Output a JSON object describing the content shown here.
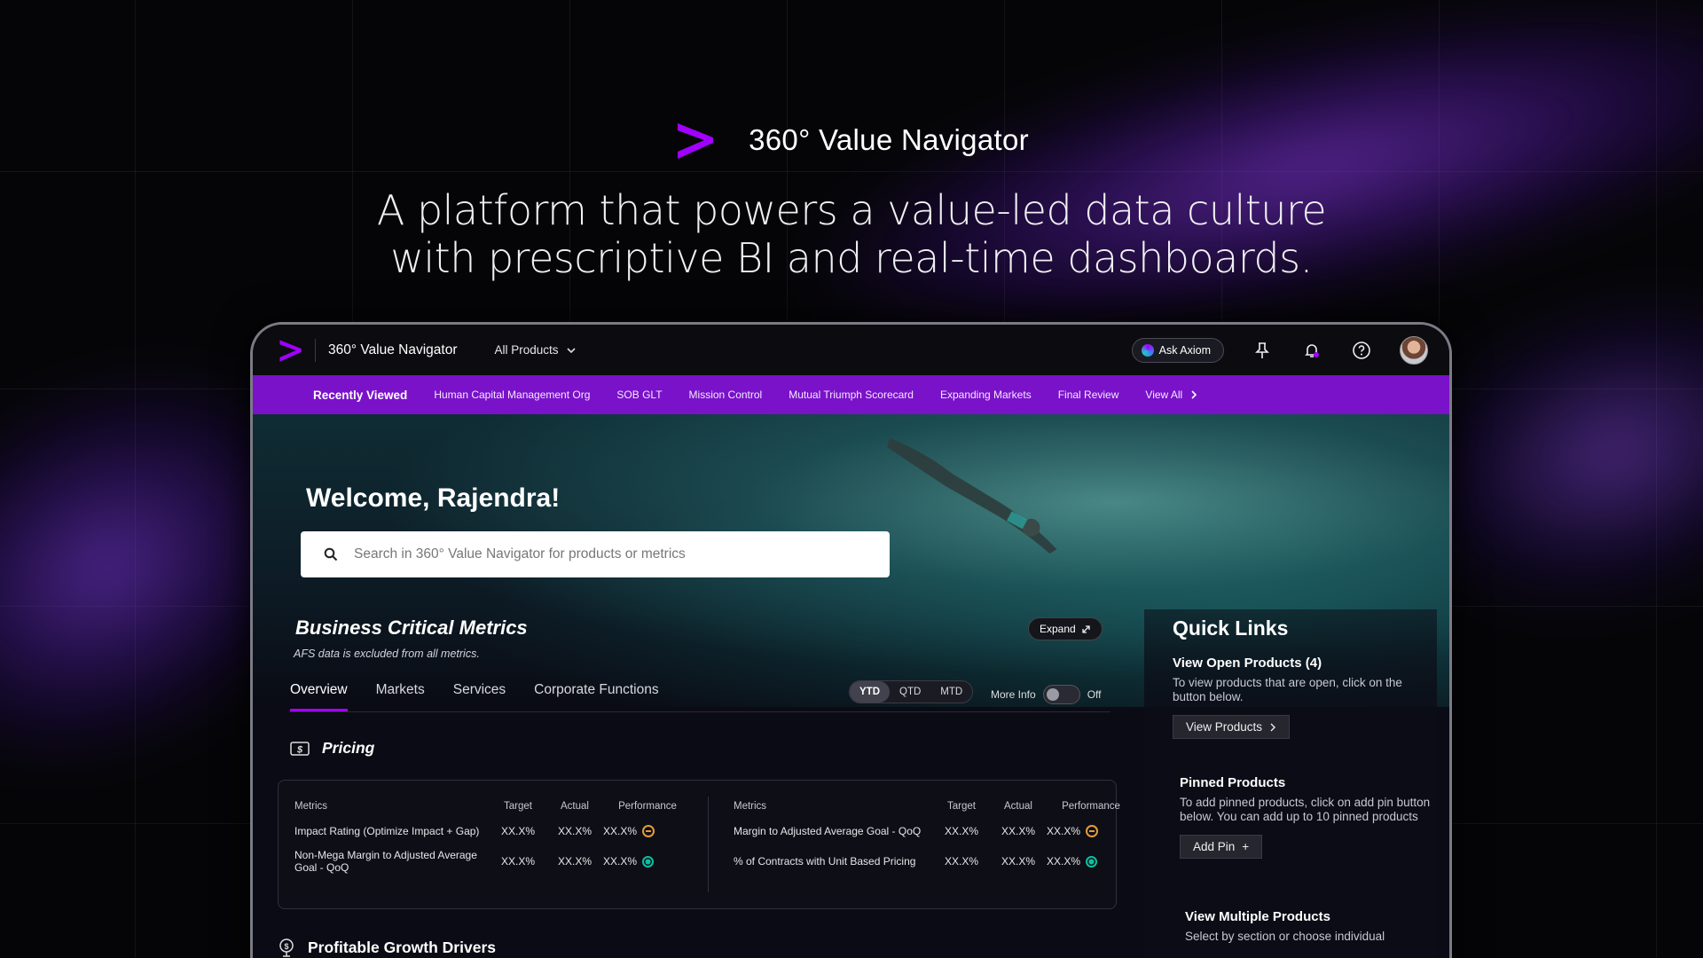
{
  "hero": {
    "brand_name": "360° Value Navigator",
    "tagline_line1": "A platform that powers a value-led data culture",
    "tagline_line2": "with prescriptive BI and real-time dashboards."
  },
  "topbar": {
    "app_name": "360° Value Navigator",
    "products_label": "All Products",
    "ask_label": "Ask Axiom"
  },
  "recent": {
    "lead": "Recently Viewed",
    "items": [
      "Human Capital Management Org",
      "SOB GLT",
      "Mission Control",
      "Mutual Triumph Scorecard",
      "Expanding Markets",
      "Final Review"
    ],
    "view_all": "View All"
  },
  "main": {
    "welcome": "Welcome, Rajendra!",
    "search_placeholder": "Search in 360° Value Navigator for products or metrics",
    "bcm_title": "Business Critical Metrics",
    "bcm_sub": "AFS data is excluded from all metrics.",
    "expand_label": "Expand",
    "tabs": [
      "Overview",
      "Markets",
      "Services",
      "Corporate Functions"
    ],
    "periods": [
      "YTD",
      "QTD",
      "MTD"
    ],
    "more_info": "More Info",
    "toggle_state": "Off",
    "pricing_title": "Pricing",
    "headers": [
      "Metrics",
      "Target",
      "Actual",
      "Performance"
    ],
    "left_rows": [
      {
        "metric": "Impact Rating (Optimize Impact + Gap)",
        "target": "XX.X%",
        "actual": "XX.X%",
        "perf": "XX.X%",
        "status": "amber"
      },
      {
        "metric": "Non-Mega Margin to Adjusted Average Goal  - QoQ",
        "target": "XX.X%",
        "actual": "XX.X%",
        "perf": "XX.X%",
        "status": "green"
      }
    ],
    "right_rows": [
      {
        "metric": "Margin to Adjusted Average Goal  - QoQ",
        "target": "XX.X%",
        "actual": "XX.X%",
        "perf": "XX.X%",
        "status": "amber"
      },
      {
        "metric": "% of Contracts with Unit Based Pricing",
        "target": "XX.X%",
        "actual": "XX.X%",
        "perf": "XX.X%",
        "status": "green"
      }
    ],
    "growth_title": "Profitable Growth Drivers"
  },
  "quick_links": {
    "title": "Quick Links",
    "open_title": "View Open Products (4)",
    "open_desc": "To view products that are open, click on the button below.",
    "open_btn": "View Products",
    "pinned_title": "Pinned Products",
    "pinned_desc": "To add pinned products, click on add pin button below. You can add up to 10 pinned products",
    "pinned_btn": "Add Pin",
    "multi_title": "View Multiple Products",
    "multi_desc": "Select by section or choose individual"
  },
  "colors": {
    "accent_purple": "#a100ff",
    "recent_bar": "#7a12c9",
    "status_green": "#0bbf9e",
    "status_amber": "#e59a3a"
  }
}
